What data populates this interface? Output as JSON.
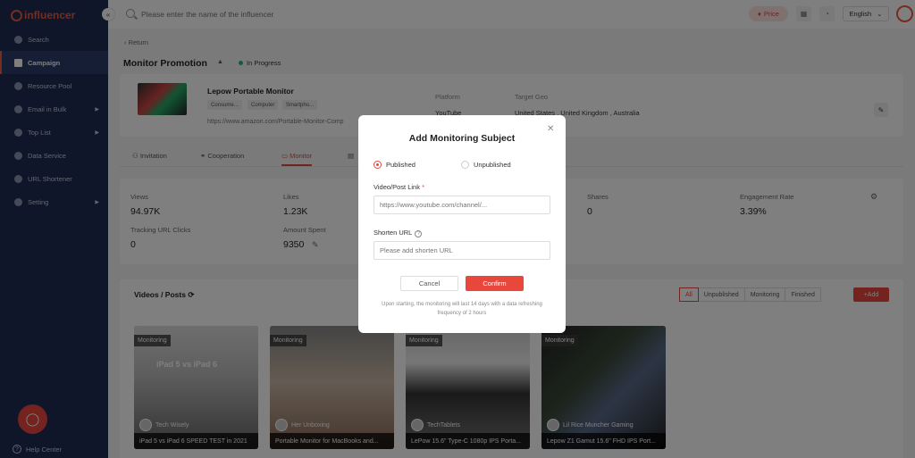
{
  "brand": {
    "logo_text": "influencer"
  },
  "sidebar": {
    "items": [
      {
        "label": "Search",
        "icon": "search-icon"
      },
      {
        "label": "Campaign",
        "icon": "campaign-icon",
        "active": true
      },
      {
        "label": "Resource Pool",
        "icon": "heart-icon"
      },
      {
        "label": "Email in Bulk",
        "icon": "mail-icon",
        "arrow": "▶"
      },
      {
        "label": "Top List",
        "icon": "list-icon",
        "arrow": "▶"
      },
      {
        "label": "Data Service",
        "icon": "data-icon"
      },
      {
        "label": "URL Shortener",
        "icon": "link-icon"
      },
      {
        "label": "Setting",
        "icon": "gear-icon",
        "arrow": "▶"
      }
    ],
    "help": "Help Center"
  },
  "topbar": {
    "search_placeholder": "Please enter the name of the influencer",
    "price_label": "Price",
    "language": "English"
  },
  "page": {
    "back_label": "Return",
    "title": "Monitor Promotion",
    "status": "In Progress"
  },
  "product": {
    "name": "Lepow Portable Monitor",
    "tags": [
      "Consume...",
      "Computer",
      "Smartpho..."
    ],
    "url": "https://www.amazon.com/Portable-Monitor-Comp",
    "platform_label": "Platform",
    "platform_value": "YouTube",
    "geo_label": "Target Geo",
    "geo_value": "United States ,  United Kingdom ,   Australia"
  },
  "tabs": [
    "Invitation",
    "Cooperation",
    "Monitor",
    ""
  ],
  "stats": {
    "views_label": "Views",
    "views_value": "94.97K",
    "likes_label": "Likes",
    "likes_value": "1.23K",
    "shares_label": "Shares",
    "shares_value": "0",
    "engagement_label": "Engagement Rate",
    "engagement_value": "3.39%",
    "clicks_label": "Tracking URL Clicks",
    "clicks_value": "0",
    "spent_label": "Amount Spent",
    "spent_value": "9350"
  },
  "videos_section": {
    "title": "Videos / Posts",
    "filters": [
      "All",
      "Unpublished",
      "Monitoring",
      "Finished"
    ],
    "add_label": "+Add"
  },
  "videos": [
    {
      "badge": "Monitoring",
      "thumb_text": "iPad 5  vs  iPad 6",
      "author": "Tech Wisely",
      "caption": "iPad 5 vs iPad 6 SPEED TEST in 2021"
    },
    {
      "badge": "Monitoring",
      "thumb_text": "",
      "author": "Her Unboxing",
      "caption": "Portable Monitor for MacBooks and..."
    },
    {
      "badge": "Monitoring",
      "thumb_text": "",
      "author": "TechTablets",
      "caption": "LePow 15.6\" Type-C 1080p IPS Porta..."
    },
    {
      "badge": "Monitoring",
      "thumb_text": "",
      "author": "Lil Rice Muncher Gaming",
      "caption": "Lepow Z1 Gamut 15.6\" FHD IPS Port..."
    }
  ],
  "modal": {
    "title": "Add Monitoring Subject",
    "radio_published": "Published",
    "radio_unpublished": "Unpublished",
    "link_label": "Video/Post Link",
    "link_required": "*",
    "link_placeholder": "https://www.youtube.com/channel/...",
    "shorten_label": "Shorten URL",
    "shorten_placeholder": "Please add shorten URL",
    "cancel_label": "Cancel",
    "confirm_label": "Confirm",
    "note": "Upon starting, the monitoring will last 14 days with a data refreshing frequency of 2 hours"
  },
  "colors": {
    "accent": "#e8473c",
    "sidebar": "#1f2d54",
    "status_green": "#2bb673"
  }
}
